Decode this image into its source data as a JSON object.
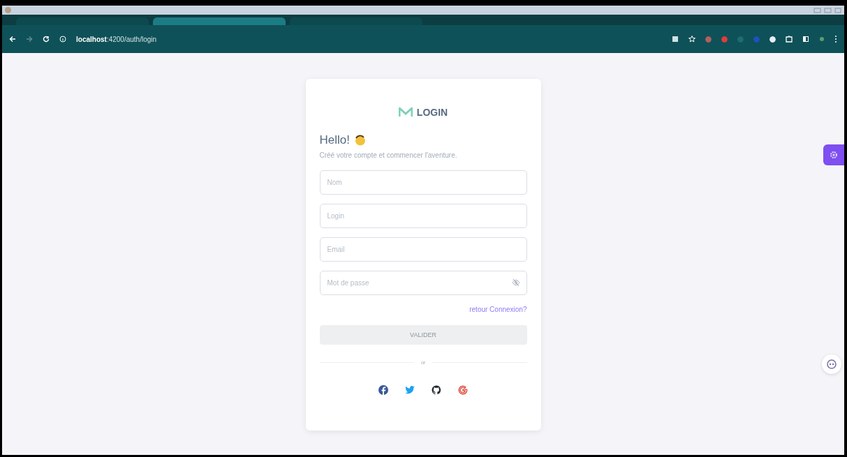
{
  "browser": {
    "tabs": [
      {
        "selected": false
      },
      {
        "selected": true
      },
      {
        "selected": false
      }
    ],
    "url": "**localhost**:4200/auth/login",
    "forward_disabled": true
  },
  "card": {
    "logo_text": "LOGIN",
    "heading": "Hello!",
    "subtitle": "Créé votre compte et commencer l'aventure.",
    "fields": [
      {
        "placeholder": "Nom",
        "kind": "text"
      },
      {
        "placeholder": "Login",
        "kind": "text"
      },
      {
        "placeholder": "Email",
        "kind": "text"
      },
      {
        "placeholder": "Mot de passe",
        "kind": "password"
      }
    ],
    "link": "retour Connexion?",
    "submit": {
      "label": "VALIDER",
      "disabled": true
    },
    "divider": "or",
    "socials": [
      {
        "kind": "facebook",
        "color": "#3b5998"
      },
      {
        "kind": "twitter",
        "color": "#1da1f2"
      },
      {
        "kind": "github",
        "color": "#24292e"
      },
      {
        "kind": "google",
        "color": "#db4437"
      }
    ]
  }
}
